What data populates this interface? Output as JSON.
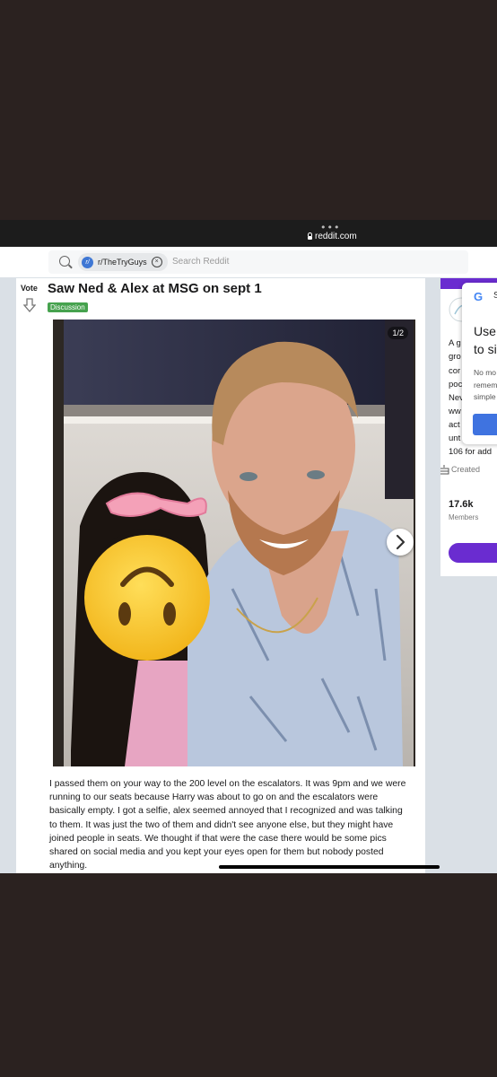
{
  "browser": {
    "url": "reddit.com"
  },
  "search": {
    "chip_label": "r/TheTryGuys",
    "placeholder": "Search Reddit"
  },
  "post": {
    "vote_label": "Vote",
    "title": "Saw Ned & Alex at MSG on sept 1",
    "flair": "Discussion",
    "image_counter": "1/2",
    "body": "I passed them on your way to the 200 level on the escalators. It was 9pm and we were running to our seats because Harry was about to go on and the escalators were basically empty. I got a selfie, alex seemed annoyed that I recognized and was talking to them. It was just the two of them and didn't see anyone else, but they might have joined people in seats. We thought if that were the case there would be some pics shared on social media and you kept your eyes open for them but nobody posted anything."
  },
  "sidebar": {
    "about_lines": [
      "A g",
      "gro",
      "cor",
      "poc",
      "Nev",
      "ww",
      "act",
      "unt",
      "106 for add"
    ],
    "created": "Created",
    "members_count": "17.6k",
    "members_label": "Members"
  },
  "google_popup": {
    "logo": "G",
    "title_lines": [
      "Use",
      "to si"
    ],
    "body_lines": [
      "No mo",
      "remem",
      "simple"
    ]
  },
  "colors": {
    "accent": "#6a2cd0",
    "flair": "#46a24e",
    "google_blue": "#3f73e0"
  }
}
